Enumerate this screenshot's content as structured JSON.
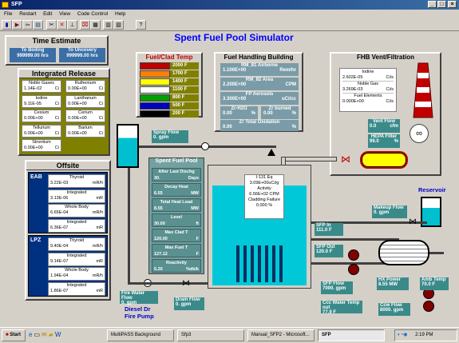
{
  "window": {
    "title": "SFP"
  },
  "menu": [
    "File",
    "Restart",
    "Edit",
    "View",
    "Code Control",
    "Help"
  ],
  "main_title": "Spent Fuel Pool Simulator",
  "time_estimate": {
    "title": "Time Estimate",
    "to_boiling_label": "To Boiling",
    "to_boiling_value": "999999.00",
    "to_boiling_unit": "hrs",
    "to_uncovery_label": "To Uncovery",
    "to_uncovery_value": "999999.00",
    "to_uncovery_unit": "hrs"
  },
  "integrated_release": {
    "title": "Integrated Release",
    "items": [
      {
        "name": "Noble Gases",
        "value": "1.14E-02",
        "unit": "Ci"
      },
      {
        "name": "Ruthenium",
        "value": "0.00E+00",
        "unit": "Ci"
      },
      {
        "name": "Iodine",
        "value": "9.11E-05",
        "unit": "Ci"
      },
      {
        "name": "Lanthanum",
        "value": "0.00E+00",
        "unit": "Ci"
      },
      {
        "name": "Cesium",
        "value": "0.00E+00",
        "unit": "Ci"
      },
      {
        "name": "Cerium",
        "value": "0.00E+00",
        "unit": "Ci"
      },
      {
        "name": "Tellurium",
        "value": "0.00E+00",
        "unit": "Ci"
      },
      {
        "name": "Barium",
        "value": "0.00E+00",
        "unit": "Ci"
      },
      {
        "name": "Strontium",
        "value": "0.00E+00",
        "unit": "Ci"
      }
    ]
  },
  "offsite": {
    "title": "Offsite",
    "eab": {
      "label": "EAB",
      "rows": [
        {
          "name": "Thyroid",
          "value": "3.22E-03",
          "unit": "mR/h"
        },
        {
          "name": "Integrated",
          "value": "3.13E-06",
          "unit": "mR"
        },
        {
          "name": "Whole Body",
          "value": "6.65E-04",
          "unit": "mR/h"
        },
        {
          "name": "Integrated",
          "value": "6.36E-07",
          "unit": "mR"
        }
      ]
    },
    "lpz": {
      "label": "LPZ",
      "rows": [
        {
          "name": "Thyroid",
          "value": "9.40E-04",
          "unit": "mR/h"
        },
        {
          "name": "Integrated",
          "value": "9.14E-07",
          "unit": "mR"
        },
        {
          "name": "Whole Body",
          "value": "1.94E-04",
          "unit": "mR/h"
        },
        {
          "name": "Integrated",
          "value": "1.86E-07",
          "unit": "mR"
        }
      ]
    }
  },
  "fuel_clad_temp": {
    "title": "Fuel/Clad Temp",
    "legend": [
      {
        "label": "2000 F",
        "color": "#c00000"
      },
      {
        "label": "1700 F",
        "color": "#ff8000"
      },
      {
        "label": "1400 F",
        "color": "#ffff00"
      },
      {
        "label": "1100 F",
        "color": "#ffffff"
      },
      {
        "label": "800 F",
        "color": "#00a000"
      },
      {
        "label": "500 F",
        "color": "#0000c0"
      },
      {
        "label": "200 F",
        "color": "#000000"
      }
    ]
  },
  "fhb": {
    "title": "Fuel Handling Building",
    "rm81_label": "RM_81 Airborne",
    "rm81_value": "1.100E+00",
    "rm81_unit": "Rem/hr",
    "rm82_label": "RM_82 Area",
    "rm82_value": "2.200E+00",
    "rm82_unit": "CPM",
    "fp_label": "FP Aerosols",
    "fp_value": "3.300E+00",
    "fp_unit": "uCi/cc",
    "zr_h2o_label": "Zr-H2O",
    "zr_h2o_value": "0.00",
    "zr_h2o_unit": "%",
    "zr_burned_label": "Zr burned",
    "zr_burned_value": "0.00",
    "zr_burned_unit": "%",
    "zr_ox_label": "Zr Total Oxidation",
    "zr_ox_value": "0.00",
    "zr_ox_unit": "%"
  },
  "vent": {
    "title": "FHB Vent/Filtration",
    "iodine_label": "Iodine",
    "iodine_value": "2.602E-05",
    "iodine_unit": "Ci/s",
    "noble_label": "Noble Gas",
    "noble_value": "3.269E-03",
    "noble_unit": "Ci/s",
    "fuel_label": "Fuel Elements",
    "fuel_value": "0.000E+00",
    "fuel_unit": "Ci/s",
    "vent_flow_label": "Vent Flow",
    "vent_flow_value": "0.0",
    "vent_flow_unit": "cfm",
    "hepa_label": "HEPA Filter",
    "hepa_value": "99.0",
    "hepa_unit": "%"
  },
  "spray": {
    "label": "Spray Flow",
    "value": "0.",
    "unit": "gpm"
  },
  "pool": {
    "title": "Spent Fuel Pool",
    "after_last_label": "After Last Dischg",
    "after_last_value": "30.",
    "after_last_unit": "Days",
    "decay_label": "Decay Heat",
    "decay_value": "6.55",
    "decay_unit": "MW",
    "total_heat_label": "Total Heat Load",
    "total_heat_value": "8.55",
    "total_heat_unit": "MW",
    "level_label": "Level",
    "level_value": "30.00",
    "level_unit": "ft",
    "max_clad_label": "Max Clad T",
    "max_clad_value": "120.00",
    "max_clad_unit": "F",
    "max_fuel_label": "Max Fuel T",
    "max_fuel_value": "127.12",
    "max_fuel_unit": "F",
    "reactivity_label": "Reactivity",
    "reactivity_value": "5.20",
    "reactivity_unit": "%dk/k"
  },
  "pool_info": {
    "i131_label": "I-131 Eq",
    "i131_value": "3.09E+00uCi/g",
    "activity_label": "Activity",
    "activity_value": "6.56E+02 CPM",
    "cladding_label": "Cladding Failure",
    "cladding_value": "0.000",
    "cladding_unit": "%"
  },
  "reservoir": {
    "label": "Reservoir"
  },
  "makeup": {
    "label": "Makeup Flow",
    "value": "0.",
    "unit": "gpm"
  },
  "sfp_in": {
    "label": "SFP In",
    "value": "111.0",
    "unit": "F"
  },
  "sfp_out": {
    "label": "SFP Out",
    "value": "120.0",
    "unit": "F"
  },
  "sfp_flow": {
    "label": "SFP Flow",
    "value": "7000.",
    "unit": "gpm"
  },
  "ccw_temp": {
    "label": "Ccc Water Temp out",
    "value": "77.9",
    "unit": "F"
  },
  "hx_power": {
    "label": "HX Power",
    "value": "8.55",
    "unit": "MW"
  },
  "amb_temp": {
    "label": "Amb Temp",
    "value": "70.0",
    "unit": "F"
  },
  "ccw_flow": {
    "label": "Ccw Flow",
    "value": "8000.",
    "unit": "gpm"
  },
  "fire_flow": {
    "label": "Fire Water Flow",
    "value": "0.",
    "unit": "gpm"
  },
  "drain_flow": {
    "label": "Drain Flow",
    "value": "0.",
    "unit": "gpm"
  },
  "diesel": {
    "line1": "Diesel Dr",
    "line2": "Fire Pump"
  },
  "taskbar": {
    "start": "Start",
    "tasks": [
      "MultiPASS Background",
      "Sfp3",
      "Manual_SFP2 - Microsoft...",
      "SFP"
    ],
    "clock": "2:19 PM"
  }
}
